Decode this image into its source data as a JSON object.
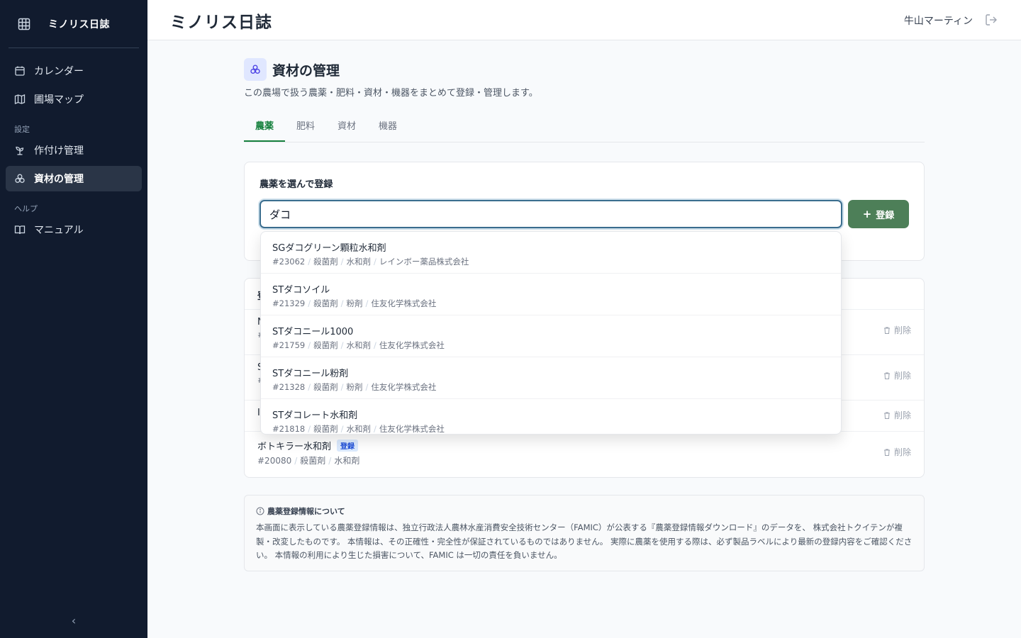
{
  "app": {
    "name": "ミノリス日誌"
  },
  "sidebar": {
    "items": [
      {
        "label": "カレンダー",
        "icon": "calendar-icon"
      },
      {
        "label": "圃場マップ",
        "icon": "map-icon"
      }
    ],
    "sections": [
      {
        "label": "設定",
        "items": [
          {
            "label": "作付け管理",
            "icon": "sprout-icon"
          },
          {
            "label": "資材の管理",
            "icon": "materials-icon",
            "active": true
          }
        ]
      },
      {
        "label": "ヘルプ",
        "items": [
          {
            "label": "マニュアル",
            "icon": "book-icon"
          }
        ]
      }
    ],
    "collapse_glyph": "‹"
  },
  "header": {
    "title": "ミノリス日誌",
    "user": "牛山マーティン"
  },
  "page": {
    "title": "資材の管理",
    "description": "この農場で扱う農薬・肥料・資材・機器をまとめて登録・管理します。",
    "tabs": [
      "農薬",
      "肥料",
      "資材",
      "機器"
    ]
  },
  "register": {
    "label": "農薬を選んで登録",
    "search_value": "ダコ",
    "button": "登録"
  },
  "dropdown": [
    {
      "name": "SGダコグリーン顆粒水和剤",
      "no": "#23062",
      "type": "殺菌剤",
      "form": "水和剤",
      "maker": "レインボー薬品株式会社"
    },
    {
      "name": "STダコソイル",
      "no": "#21329",
      "type": "殺菌剤",
      "form": "粉剤",
      "maker": "住友化学株式会社"
    },
    {
      "name": "STダコニール1000",
      "no": "#21759",
      "type": "殺菌剤",
      "form": "水和剤",
      "maker": "住友化学株式会社"
    },
    {
      "name": "STダコニール粉剤",
      "no": "#21328",
      "type": "殺菌剤",
      "form": "粉剤",
      "maker": "住友化学株式会社"
    },
    {
      "name": "STダコレート水和剤",
      "no": "#21818",
      "type": "殺菌剤",
      "form": "水和剤",
      "maker": "住友化学株式会社"
    }
  ],
  "registered": {
    "header": "登",
    "rows": [
      {
        "name": "N",
        "meta": "#"
      },
      {
        "name": "S",
        "meta": "#"
      },
      {
        "name": "I",
        "meta": ""
      },
      {
        "name": "ボトキラー水和剤",
        "tag": "登録",
        "no": "#20080",
        "type": "殺菌剤",
        "form": "水和剤"
      }
    ],
    "delete_label": "削除"
  },
  "notice": {
    "title": "農薬登録情報について",
    "body": "本画面に表示している農薬登録情報は、独立行政法人農林水産消費安全技術センター（FAMIC）が公表する『農薬登録情報ダウンロード』のデータを、 株式会社トクイテンが複製・改変したものです。 本情報は、その正確性・完全性が保証されているものではありません。 実際に農薬を使用する際は、必ず製品ラベルにより最新の登録内容をご確認ください。 本情報の利用により生じた損害について、FAMIC は一切の責任を負いません。"
  },
  "colors": {
    "sidebar": "#111b2e",
    "accent_green": "#4d7f58",
    "tab_active": "#15803d"
  }
}
